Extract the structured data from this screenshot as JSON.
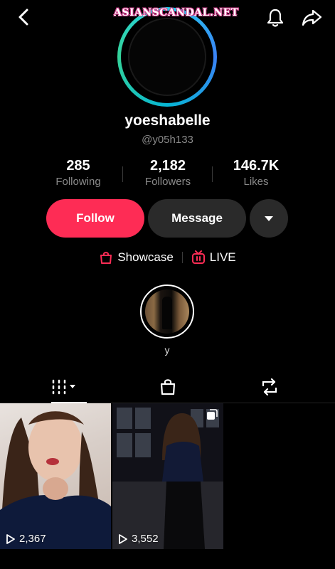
{
  "watermark": "ASIANSCANDAL.NET",
  "profile": {
    "username": "yoeshabelle",
    "handle": "@y05h133"
  },
  "stats": {
    "following": {
      "value": "285",
      "label": "Following"
    },
    "followers": {
      "value": "2,182",
      "label": "Followers"
    },
    "likes": {
      "value": "146.7K",
      "label": "Likes"
    }
  },
  "actions": {
    "follow": "Follow",
    "message": "Message"
  },
  "links": {
    "showcase": "Showcase",
    "live": "LIVE"
  },
  "highlight": {
    "label": "y"
  },
  "videos": [
    {
      "views": "2,367"
    },
    {
      "views": "3,552"
    }
  ],
  "colors": {
    "accent": "#fe2c55",
    "background": "#000000"
  },
  "icons": [
    "back-icon",
    "bell-icon",
    "share-icon",
    "bag-icon",
    "live-icon",
    "grid-icon",
    "repost-icon",
    "play-icon",
    "multi-photo-icon"
  ]
}
